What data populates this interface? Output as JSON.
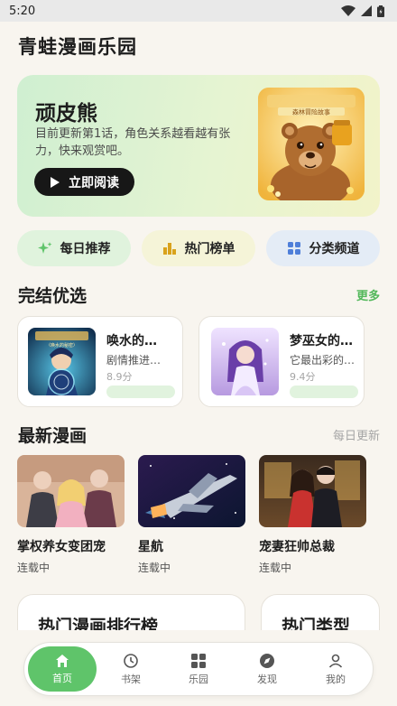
{
  "status_bar": {
    "time": "5:20"
  },
  "app": {
    "title": "青蛙漫画乐园"
  },
  "hero": {
    "title": "顽皮熊",
    "desc": "目前更新第1话，角色关系越看越有张力，快来观赏吧。",
    "button": "立即阅读",
    "cover_subtitle": "森林冒险故事"
  },
  "chips": [
    {
      "label": "每日推荐",
      "icon": "sparkle-icon"
    },
    {
      "label": "热门榜单",
      "icon": "bar-chart-icon"
    },
    {
      "label": "分类频道",
      "icon": "grid-icon"
    }
  ],
  "finished": {
    "title": "完结优选",
    "more": "更多",
    "items": [
      {
        "title": "唤水的…",
        "desc": "剧情推进…",
        "score": "8.9分",
        "cover_text": "〈唤水的秘密〉"
      },
      {
        "title": "梦巫女的…",
        "desc": "它最出彩的…",
        "score": "9.4分"
      }
    ]
  },
  "latest": {
    "title": "最新漫画",
    "sub": "每日更新",
    "items": [
      {
        "name": "掌权养女变团宠",
        "status": "连载中"
      },
      {
        "name": "星航",
        "status": "连载中"
      },
      {
        "name": "宠妻狂帅总裁",
        "status": "连载中"
      }
    ]
  },
  "bottom_cards": {
    "ranking": "热门漫画排行榜",
    "types": "热门类型"
  },
  "nav": {
    "items": [
      {
        "label": "首页",
        "icon": "home-icon"
      },
      {
        "label": "书架",
        "icon": "history-icon"
      },
      {
        "label": "乐园",
        "icon": "apps-icon"
      },
      {
        "label": "发现",
        "icon": "compass-icon"
      },
      {
        "label": "我的",
        "icon": "user-icon"
      }
    ]
  },
  "colors": {
    "accent": "#5fc46a",
    "more": "#52b85a",
    "dark_button": "#171717"
  }
}
